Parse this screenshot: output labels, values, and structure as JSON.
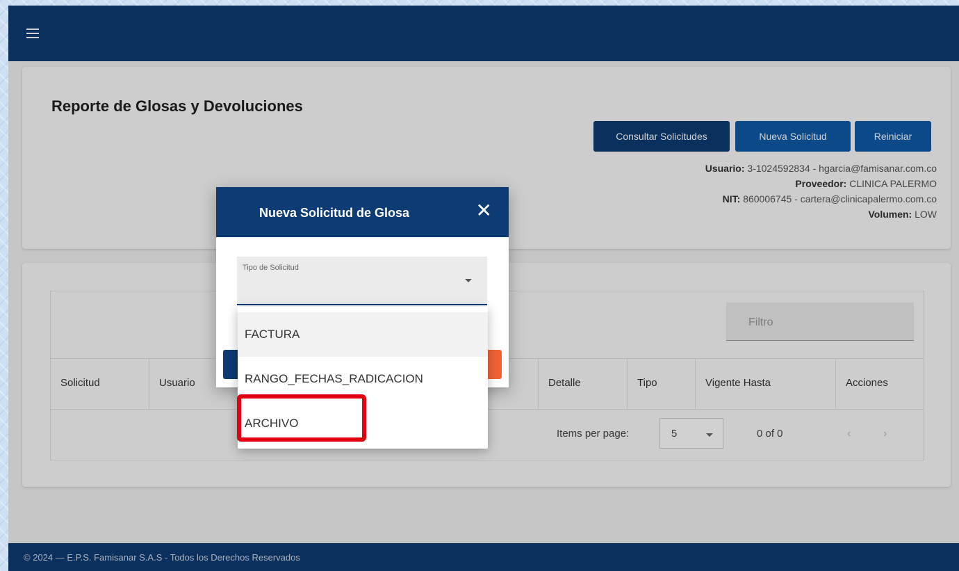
{
  "header": {
    "menu_icon": "menu-icon"
  },
  "report": {
    "title": "Reporte de Glosas y Devoluciones",
    "buttons": {
      "consultar": "Consultar Solicitudes",
      "nueva": "Nueva Solicitud",
      "reiniciar": "Reiniciar"
    },
    "info": {
      "usuario_label": "Usuario:",
      "usuario_value": "3-1024592834 - hgarcia@famisanar.com.co",
      "proveedor_label": "Proveedor:",
      "proveedor_value": "CLINICA PALERMO",
      "nit_label": "NIT:",
      "nit_value": "860006745 - cartera@clinicapalermo.com.co",
      "volumen_label": "Volumen:",
      "volumen_value": "LOW"
    }
  },
  "table": {
    "filter_placeholder": "Filtro",
    "columns": [
      "Solicitud",
      "Usuario",
      "Detalle",
      "Tipo",
      "Vigente Hasta",
      "Acciones"
    ],
    "paginator": {
      "items_per_page_label": "Items per page:",
      "items_per_page_value": "5",
      "range": "0 of 0",
      "prev": "‹",
      "next": "›"
    }
  },
  "footer": {
    "text": "© 2024 — E.P.S. Famisanar S.A.S - Todos los Derechos Reservados"
  },
  "dialog": {
    "title": "Nueva Solicitud de Glosa",
    "close": "✕",
    "select_label": "Tipo de Solicitud",
    "options": [
      "FACTURA",
      "RANGO_FECHAS_RADICACION",
      "ARCHIVO"
    ],
    "highlighted_option": "ARCHIVO"
  },
  "colors": {
    "primary": "#0d3b73",
    "secondary": "#0f5aa8",
    "danger": "#f06236",
    "highlight": "#e00012"
  }
}
